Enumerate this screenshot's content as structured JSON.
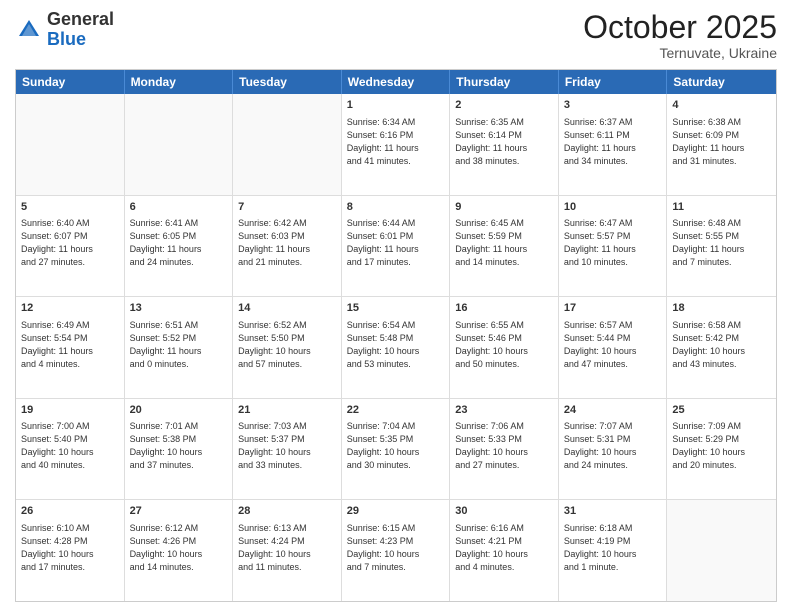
{
  "header": {
    "logo_general": "General",
    "logo_blue": "Blue",
    "month": "October 2025",
    "location": "Ternuvate, Ukraine"
  },
  "weekdays": [
    "Sunday",
    "Monday",
    "Tuesday",
    "Wednesday",
    "Thursday",
    "Friday",
    "Saturday"
  ],
  "rows": [
    {
      "cells": [
        {
          "day": "",
          "text": "",
          "empty": true
        },
        {
          "day": "",
          "text": "",
          "empty": true
        },
        {
          "day": "",
          "text": "",
          "empty": true
        },
        {
          "day": "1",
          "text": "Sunrise: 6:34 AM\nSunset: 6:16 PM\nDaylight: 11 hours\nand 41 minutes."
        },
        {
          "day": "2",
          "text": "Sunrise: 6:35 AM\nSunset: 6:14 PM\nDaylight: 11 hours\nand 38 minutes."
        },
        {
          "day": "3",
          "text": "Sunrise: 6:37 AM\nSunset: 6:11 PM\nDaylight: 11 hours\nand 34 minutes."
        },
        {
          "day": "4",
          "text": "Sunrise: 6:38 AM\nSunset: 6:09 PM\nDaylight: 11 hours\nand 31 minutes."
        }
      ]
    },
    {
      "cells": [
        {
          "day": "5",
          "text": "Sunrise: 6:40 AM\nSunset: 6:07 PM\nDaylight: 11 hours\nand 27 minutes."
        },
        {
          "day": "6",
          "text": "Sunrise: 6:41 AM\nSunset: 6:05 PM\nDaylight: 11 hours\nand 24 minutes."
        },
        {
          "day": "7",
          "text": "Sunrise: 6:42 AM\nSunset: 6:03 PM\nDaylight: 11 hours\nand 21 minutes."
        },
        {
          "day": "8",
          "text": "Sunrise: 6:44 AM\nSunset: 6:01 PM\nDaylight: 11 hours\nand 17 minutes."
        },
        {
          "day": "9",
          "text": "Sunrise: 6:45 AM\nSunset: 5:59 PM\nDaylight: 11 hours\nand 14 minutes."
        },
        {
          "day": "10",
          "text": "Sunrise: 6:47 AM\nSunset: 5:57 PM\nDaylight: 11 hours\nand 10 minutes."
        },
        {
          "day": "11",
          "text": "Sunrise: 6:48 AM\nSunset: 5:55 PM\nDaylight: 11 hours\nand 7 minutes."
        }
      ]
    },
    {
      "cells": [
        {
          "day": "12",
          "text": "Sunrise: 6:49 AM\nSunset: 5:54 PM\nDaylight: 11 hours\nand 4 minutes."
        },
        {
          "day": "13",
          "text": "Sunrise: 6:51 AM\nSunset: 5:52 PM\nDaylight: 11 hours\nand 0 minutes."
        },
        {
          "day": "14",
          "text": "Sunrise: 6:52 AM\nSunset: 5:50 PM\nDaylight: 10 hours\nand 57 minutes."
        },
        {
          "day": "15",
          "text": "Sunrise: 6:54 AM\nSunset: 5:48 PM\nDaylight: 10 hours\nand 53 minutes."
        },
        {
          "day": "16",
          "text": "Sunrise: 6:55 AM\nSunset: 5:46 PM\nDaylight: 10 hours\nand 50 minutes."
        },
        {
          "day": "17",
          "text": "Sunrise: 6:57 AM\nSunset: 5:44 PM\nDaylight: 10 hours\nand 47 minutes."
        },
        {
          "day": "18",
          "text": "Sunrise: 6:58 AM\nSunset: 5:42 PM\nDaylight: 10 hours\nand 43 minutes."
        }
      ]
    },
    {
      "cells": [
        {
          "day": "19",
          "text": "Sunrise: 7:00 AM\nSunset: 5:40 PM\nDaylight: 10 hours\nand 40 minutes."
        },
        {
          "day": "20",
          "text": "Sunrise: 7:01 AM\nSunset: 5:38 PM\nDaylight: 10 hours\nand 37 minutes."
        },
        {
          "day": "21",
          "text": "Sunrise: 7:03 AM\nSunset: 5:37 PM\nDaylight: 10 hours\nand 33 minutes."
        },
        {
          "day": "22",
          "text": "Sunrise: 7:04 AM\nSunset: 5:35 PM\nDaylight: 10 hours\nand 30 minutes."
        },
        {
          "day": "23",
          "text": "Sunrise: 7:06 AM\nSunset: 5:33 PM\nDaylight: 10 hours\nand 27 minutes."
        },
        {
          "day": "24",
          "text": "Sunrise: 7:07 AM\nSunset: 5:31 PM\nDaylight: 10 hours\nand 24 minutes."
        },
        {
          "day": "25",
          "text": "Sunrise: 7:09 AM\nSunset: 5:29 PM\nDaylight: 10 hours\nand 20 minutes."
        }
      ]
    },
    {
      "cells": [
        {
          "day": "26",
          "text": "Sunrise: 6:10 AM\nSunset: 4:28 PM\nDaylight: 10 hours\nand 17 minutes."
        },
        {
          "day": "27",
          "text": "Sunrise: 6:12 AM\nSunset: 4:26 PM\nDaylight: 10 hours\nand 14 minutes."
        },
        {
          "day": "28",
          "text": "Sunrise: 6:13 AM\nSunset: 4:24 PM\nDaylight: 10 hours\nand 11 minutes."
        },
        {
          "day": "29",
          "text": "Sunrise: 6:15 AM\nSunset: 4:23 PM\nDaylight: 10 hours\nand 7 minutes."
        },
        {
          "day": "30",
          "text": "Sunrise: 6:16 AM\nSunset: 4:21 PM\nDaylight: 10 hours\nand 4 minutes."
        },
        {
          "day": "31",
          "text": "Sunrise: 6:18 AM\nSunset: 4:19 PM\nDaylight: 10 hours\nand 1 minute."
        },
        {
          "day": "",
          "text": "",
          "empty": true
        }
      ]
    }
  ]
}
